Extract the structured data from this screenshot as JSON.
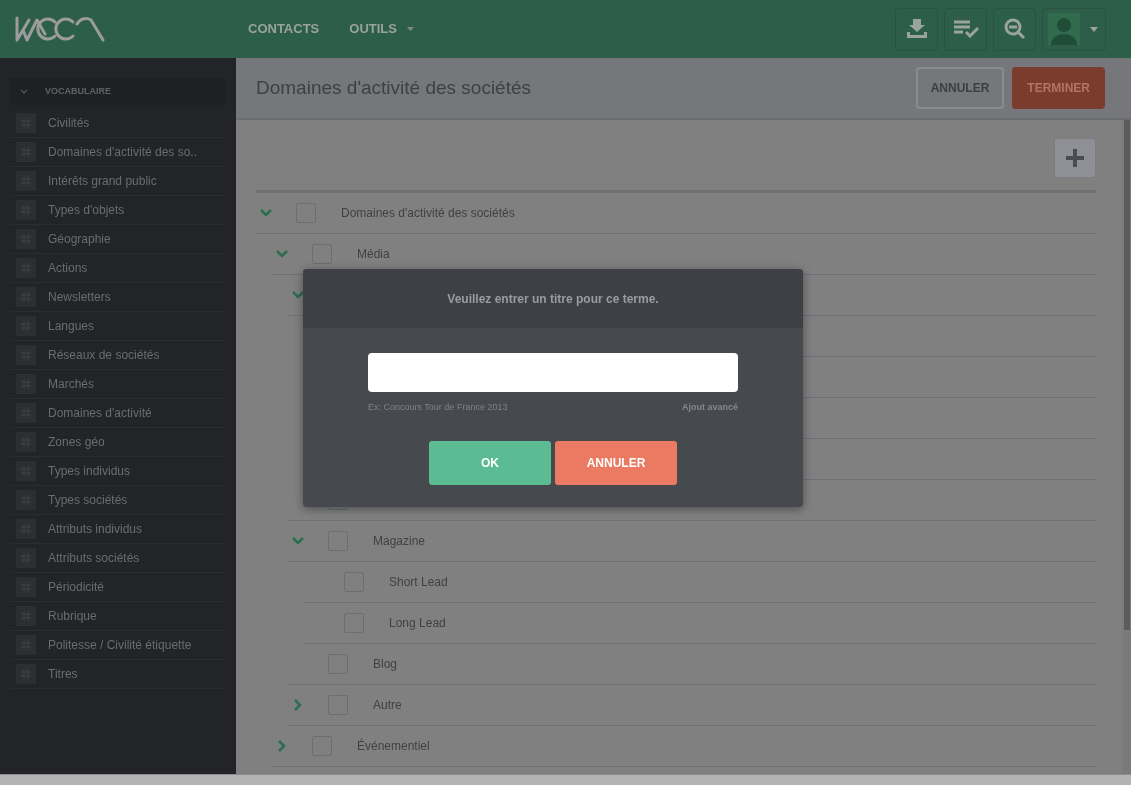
{
  "header": {
    "nav": [
      {
        "label": "CONTACTS",
        "dropdown": false
      },
      {
        "label": "OUTILS",
        "dropdown": true
      }
    ]
  },
  "sidebar": {
    "section": "VOCABULAIRE",
    "expanded": true,
    "items": [
      "Civilités",
      "Domaines d'activité des so..",
      "Intérêts grand public",
      "Types d'objets",
      "Géographie",
      "Actions",
      "Newsletters",
      "Langues",
      "Réseaux de sociétés",
      "Marchés",
      "Domaines d'activité",
      "Zones géo",
      "Types individus",
      "Types sociétés",
      "Attributs individus",
      "Attributs sociétés",
      "Périodicité",
      "Rubrique",
      "Politesse / Civilité étiquette",
      "Titres"
    ]
  },
  "page": {
    "title": "Domaines d'activité des sociétés",
    "buttons": [
      {
        "label": "ANNULER",
        "kind": "secondary"
      },
      {
        "label": "TERMINER",
        "kind": "primary"
      }
    ]
  },
  "tree": [
    {
      "kind": "row",
      "label": "Domaines d'activité des sociétés",
      "checked": false,
      "expanded": true,
      "children": [
        {
          "kind": "row",
          "label": "Média",
          "checked": false,
          "expanded": true,
          "children": [
            {
              "kind": "covered",
              "expanded": true,
              "children": [
                {
                  "kind": "hidden"
                },
                {
                  "kind": "hidden"
                },
                {
                  "kind": "hidden"
                },
                {
                  "kind": "hidden"
                }
              ]
            },
            {
              "kind": "covered",
              "checked": false
            },
            {
              "kind": "row",
              "label": "Magazine",
              "checked": false,
              "expanded": true,
              "children": [
                {
                  "kind": "row",
                  "label": "Short Lead",
                  "checked": false
                },
                {
                  "kind": "row",
                  "label": "Long Lead",
                  "checked": false
                }
              ]
            },
            {
              "kind": "row",
              "label": "Blog",
              "checked": false
            },
            {
              "kind": "row",
              "label": "Autre",
              "checked": false,
              "expanded": false
            }
          ]
        },
        {
          "kind": "row",
          "label": "Événementiel",
          "checked": false,
          "expanded": false
        }
      ]
    }
  ],
  "dialog": {
    "title": "Veuillez entrer un titre pour ce terme.",
    "hint": "Ex: Concours Tour de France 2013",
    "link": "Ajout avancé",
    "buttons": [
      {
        "label": "OK",
        "kind": "confirm"
      },
      {
        "label": "ANNULER",
        "kind": "cancel"
      }
    ]
  }
}
